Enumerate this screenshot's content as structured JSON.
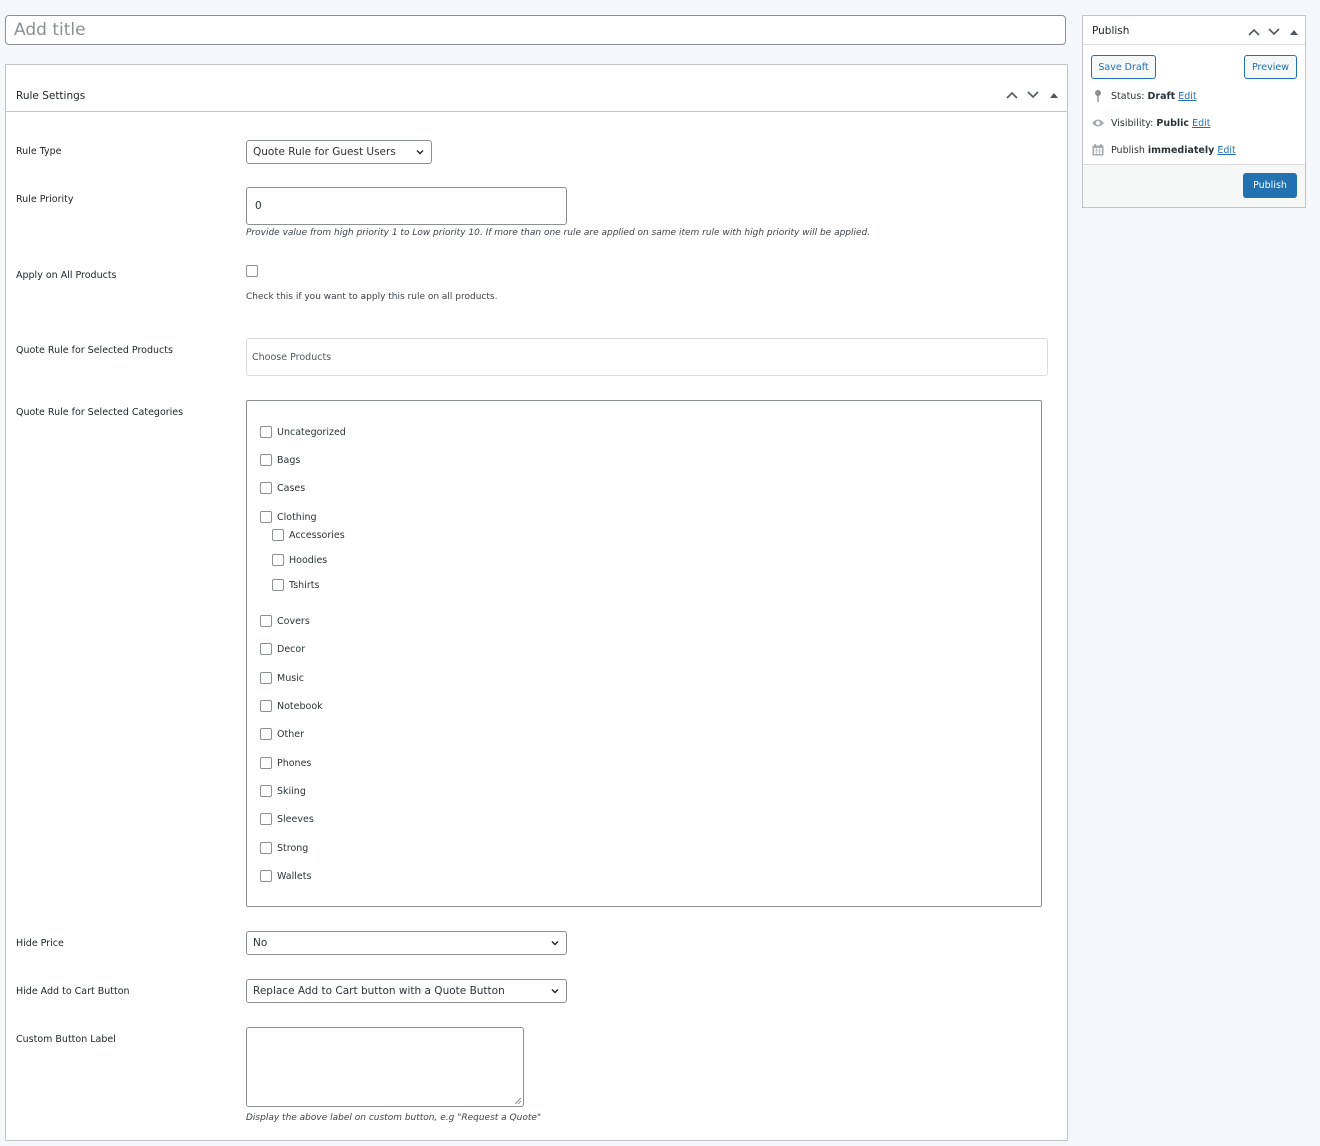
{
  "title_field": {
    "placeholder": "Add title",
    "value": ""
  },
  "rule_settings": {
    "heading": "Rule Settings",
    "rule_type": {
      "label": "Rule Type",
      "value": "Quote Rule for Guest Users"
    },
    "rule_priority": {
      "label": "Rule Priority",
      "value": "0",
      "description": "Provide value from high priority 1 to Low priority 10. If more than one rule are applied on same item rule with high priority will be applied."
    },
    "apply_all": {
      "label": "Apply on All Products",
      "checked": false,
      "description": "Check this if you want to apply this rule on all products."
    },
    "selected_products": {
      "label": "Quote Rule for Selected Products",
      "placeholder": "Choose Products"
    },
    "selected_categories": {
      "label": "Quote Rule for Selected Categories",
      "items": [
        {
          "label": "Uncategorized",
          "level": 0,
          "checked": false
        },
        {
          "label": "Bags",
          "level": 0,
          "checked": false
        },
        {
          "label": "Cases",
          "level": 0,
          "checked": false
        },
        {
          "label": "Clothing",
          "level": 0,
          "checked": false
        },
        {
          "label": "Accessories",
          "level": 1,
          "checked": false
        },
        {
          "label": "Hoodies",
          "level": 1,
          "checked": false
        },
        {
          "label": "Tshirts",
          "level": 1,
          "checked": false
        },
        {
          "label": "Covers",
          "level": 0,
          "checked": false
        },
        {
          "label": "Decor",
          "level": 0,
          "checked": false
        },
        {
          "label": "Music",
          "level": 0,
          "checked": false
        },
        {
          "label": "Notebook",
          "level": 0,
          "checked": false
        },
        {
          "label": "Other",
          "level": 0,
          "checked": false
        },
        {
          "label": "Phones",
          "level": 0,
          "checked": false
        },
        {
          "label": "Skiing",
          "level": 0,
          "checked": false
        },
        {
          "label": "Sleeves",
          "level": 0,
          "checked": false
        },
        {
          "label": "Strong",
          "level": 0,
          "checked": false
        },
        {
          "label": "Wallets",
          "level": 0,
          "checked": false
        }
      ]
    },
    "hide_price": {
      "label": "Hide Price",
      "value": "No"
    },
    "hide_cart": {
      "label": "Hide Add to Cart Button",
      "value": "Replace Add to Cart button with a Quote Button"
    },
    "custom_label": {
      "label": "Custom Button Label",
      "value": "",
      "description": "Display the above label on custom button, e.g \"Request a Quote\""
    }
  },
  "publish": {
    "heading": "Publish",
    "save_draft": "Save Draft",
    "preview": "Preview",
    "status_label": "Status:",
    "status_value": "Draft",
    "visibility_label": "Visibility:",
    "visibility_value": "Public",
    "publish_label": "Publish",
    "publish_value": "immediately",
    "edit": "Edit",
    "publish_button": "Publish"
  },
  "colors": {
    "accent": "#2271b1",
    "border": "#c3c4c7",
    "background": "#f6f7fb"
  },
  "icons": [
    "chevron-up-icon",
    "chevron-down-icon",
    "triangle-up-icon",
    "pin-icon",
    "eye-icon",
    "calendar-icon"
  ]
}
